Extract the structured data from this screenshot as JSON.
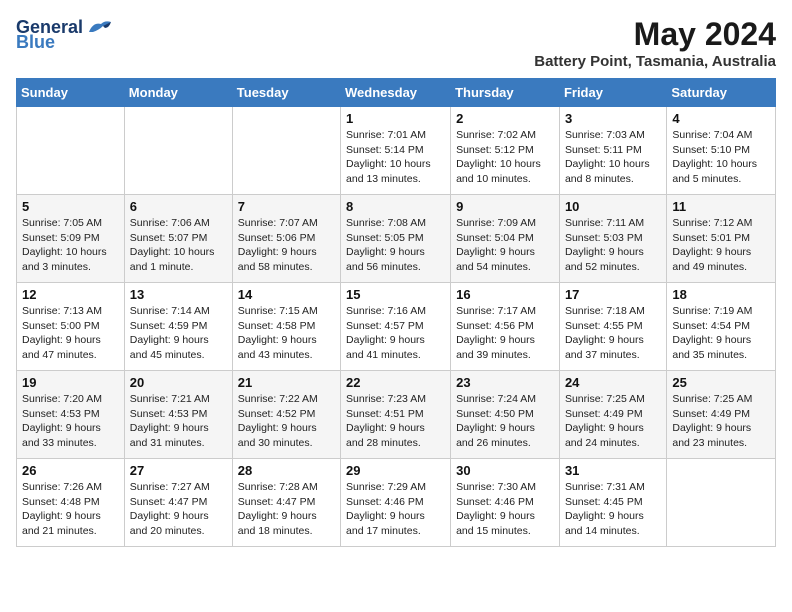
{
  "header": {
    "logo_general": "General",
    "logo_blue": "Blue",
    "month_title": "May 2024",
    "location": "Battery Point, Tasmania, Australia"
  },
  "weekdays": [
    "Sunday",
    "Monday",
    "Tuesday",
    "Wednesday",
    "Thursday",
    "Friday",
    "Saturday"
  ],
  "weeks": [
    [
      {
        "day": "",
        "info": ""
      },
      {
        "day": "",
        "info": ""
      },
      {
        "day": "",
        "info": ""
      },
      {
        "day": "1",
        "info": "Sunrise: 7:01 AM\nSunset: 5:14 PM\nDaylight: 10 hours\nand 13 minutes."
      },
      {
        "day": "2",
        "info": "Sunrise: 7:02 AM\nSunset: 5:12 PM\nDaylight: 10 hours\nand 10 minutes."
      },
      {
        "day": "3",
        "info": "Sunrise: 7:03 AM\nSunset: 5:11 PM\nDaylight: 10 hours\nand 8 minutes."
      },
      {
        "day": "4",
        "info": "Sunrise: 7:04 AM\nSunset: 5:10 PM\nDaylight: 10 hours\nand 5 minutes."
      }
    ],
    [
      {
        "day": "5",
        "info": "Sunrise: 7:05 AM\nSunset: 5:09 PM\nDaylight: 10 hours\nand 3 minutes."
      },
      {
        "day": "6",
        "info": "Sunrise: 7:06 AM\nSunset: 5:07 PM\nDaylight: 10 hours\nand 1 minute."
      },
      {
        "day": "7",
        "info": "Sunrise: 7:07 AM\nSunset: 5:06 PM\nDaylight: 9 hours\nand 58 minutes."
      },
      {
        "day": "8",
        "info": "Sunrise: 7:08 AM\nSunset: 5:05 PM\nDaylight: 9 hours\nand 56 minutes."
      },
      {
        "day": "9",
        "info": "Sunrise: 7:09 AM\nSunset: 5:04 PM\nDaylight: 9 hours\nand 54 minutes."
      },
      {
        "day": "10",
        "info": "Sunrise: 7:11 AM\nSunset: 5:03 PM\nDaylight: 9 hours\nand 52 minutes."
      },
      {
        "day": "11",
        "info": "Sunrise: 7:12 AM\nSunset: 5:01 PM\nDaylight: 9 hours\nand 49 minutes."
      }
    ],
    [
      {
        "day": "12",
        "info": "Sunrise: 7:13 AM\nSunset: 5:00 PM\nDaylight: 9 hours\nand 47 minutes."
      },
      {
        "day": "13",
        "info": "Sunrise: 7:14 AM\nSunset: 4:59 PM\nDaylight: 9 hours\nand 45 minutes."
      },
      {
        "day": "14",
        "info": "Sunrise: 7:15 AM\nSunset: 4:58 PM\nDaylight: 9 hours\nand 43 minutes."
      },
      {
        "day": "15",
        "info": "Sunrise: 7:16 AM\nSunset: 4:57 PM\nDaylight: 9 hours\nand 41 minutes."
      },
      {
        "day": "16",
        "info": "Sunrise: 7:17 AM\nSunset: 4:56 PM\nDaylight: 9 hours\nand 39 minutes."
      },
      {
        "day": "17",
        "info": "Sunrise: 7:18 AM\nSunset: 4:55 PM\nDaylight: 9 hours\nand 37 minutes."
      },
      {
        "day": "18",
        "info": "Sunrise: 7:19 AM\nSunset: 4:54 PM\nDaylight: 9 hours\nand 35 minutes."
      }
    ],
    [
      {
        "day": "19",
        "info": "Sunrise: 7:20 AM\nSunset: 4:53 PM\nDaylight: 9 hours\nand 33 minutes."
      },
      {
        "day": "20",
        "info": "Sunrise: 7:21 AM\nSunset: 4:53 PM\nDaylight: 9 hours\nand 31 minutes."
      },
      {
        "day": "21",
        "info": "Sunrise: 7:22 AM\nSunset: 4:52 PM\nDaylight: 9 hours\nand 30 minutes."
      },
      {
        "day": "22",
        "info": "Sunrise: 7:23 AM\nSunset: 4:51 PM\nDaylight: 9 hours\nand 28 minutes."
      },
      {
        "day": "23",
        "info": "Sunrise: 7:24 AM\nSunset: 4:50 PM\nDaylight: 9 hours\nand 26 minutes."
      },
      {
        "day": "24",
        "info": "Sunrise: 7:25 AM\nSunset: 4:49 PM\nDaylight: 9 hours\nand 24 minutes."
      },
      {
        "day": "25",
        "info": "Sunrise: 7:25 AM\nSunset: 4:49 PM\nDaylight: 9 hours\nand 23 minutes."
      }
    ],
    [
      {
        "day": "26",
        "info": "Sunrise: 7:26 AM\nSunset: 4:48 PM\nDaylight: 9 hours\nand 21 minutes."
      },
      {
        "day": "27",
        "info": "Sunrise: 7:27 AM\nSunset: 4:47 PM\nDaylight: 9 hours\nand 20 minutes."
      },
      {
        "day": "28",
        "info": "Sunrise: 7:28 AM\nSunset: 4:47 PM\nDaylight: 9 hours\nand 18 minutes."
      },
      {
        "day": "29",
        "info": "Sunrise: 7:29 AM\nSunset: 4:46 PM\nDaylight: 9 hours\nand 17 minutes."
      },
      {
        "day": "30",
        "info": "Sunrise: 7:30 AM\nSunset: 4:46 PM\nDaylight: 9 hours\nand 15 minutes."
      },
      {
        "day": "31",
        "info": "Sunrise: 7:31 AM\nSunset: 4:45 PM\nDaylight: 9 hours\nand 14 minutes."
      },
      {
        "day": "",
        "info": ""
      }
    ]
  ]
}
